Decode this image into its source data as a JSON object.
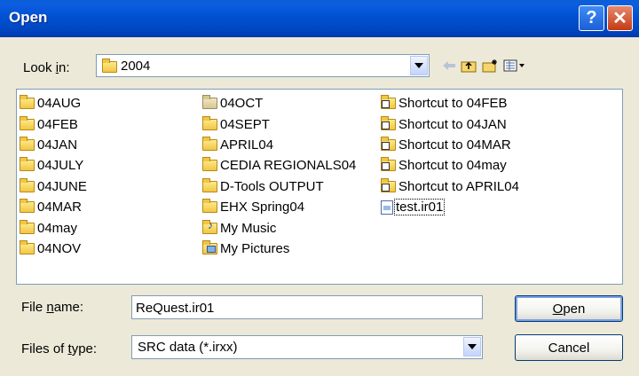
{
  "dialog": {
    "title": "Open"
  },
  "titlebar": {
    "help_glyph": "?",
    "close_glyph": "✕"
  },
  "look_in": {
    "label_pre": "Look ",
    "label_u": "i",
    "label_post": "n:",
    "value": "2004"
  },
  "toolbar": {
    "icons": [
      "back-arrow-icon",
      "up-folder-icon",
      "new-folder-icon",
      "view-menu-icon"
    ]
  },
  "files": {
    "column1": [
      {
        "name": "04AUG",
        "icon": "folder-icon"
      },
      {
        "name": "04FEB",
        "icon": "folder-icon"
      },
      {
        "name": "04JAN",
        "icon": "folder-icon"
      },
      {
        "name": "04JULY",
        "icon": "folder-icon"
      },
      {
        "name": "04JUNE",
        "icon": "folder-icon"
      },
      {
        "name": "04MAR",
        "icon": "folder-icon"
      },
      {
        "name": "04may",
        "icon": "folder-icon"
      },
      {
        "name": "04NOV",
        "icon": "folder-icon"
      }
    ],
    "column2": [
      {
        "name": "04OCT",
        "icon": "folder-icon"
      },
      {
        "name": "04SEPT",
        "icon": "folder-icon"
      },
      {
        "name": "APRIL04",
        "icon": "folder-icon"
      },
      {
        "name": "CEDIA REGIONALS04",
        "icon": "folder-icon"
      },
      {
        "name": "D-Tools OUTPUT",
        "icon": "folder-icon"
      },
      {
        "name": "EHX Spring04",
        "icon": "folder-icon"
      },
      {
        "name": "My Music",
        "icon": "music-folder-icon"
      },
      {
        "name": "My Pictures",
        "icon": "pictures-folder-icon"
      }
    ],
    "column3": [
      {
        "name": "Shortcut to 04FEB",
        "icon": "shortcut-folder-icon"
      },
      {
        "name": "Shortcut to 04JAN",
        "icon": "shortcut-folder-icon"
      },
      {
        "name": "Shortcut to 04MAR",
        "icon": "shortcut-folder-icon"
      },
      {
        "name": "Shortcut to 04may",
        "icon": "shortcut-folder-icon"
      },
      {
        "name": "Shortcut to APRIL04",
        "icon": "shortcut-folder-icon"
      },
      {
        "name": "test.ir01",
        "icon": "file-icon"
      }
    ]
  },
  "file_name": {
    "label_pre": "File ",
    "label_u": "n",
    "label_post": "ame:",
    "value": "ReQuest.ir01"
  },
  "file_type": {
    "label_pre": "Files of ",
    "label_u": "t",
    "label_post": "ype:",
    "value": "SRC data (*.irxx)"
  },
  "buttons": {
    "open_u": "O",
    "open_rest": "pen",
    "cancel": "Cancel"
  },
  "colors": {
    "titlebar": "#0051d2",
    "dialog_bg": "#ece9d8",
    "border": "#7f9db9"
  }
}
